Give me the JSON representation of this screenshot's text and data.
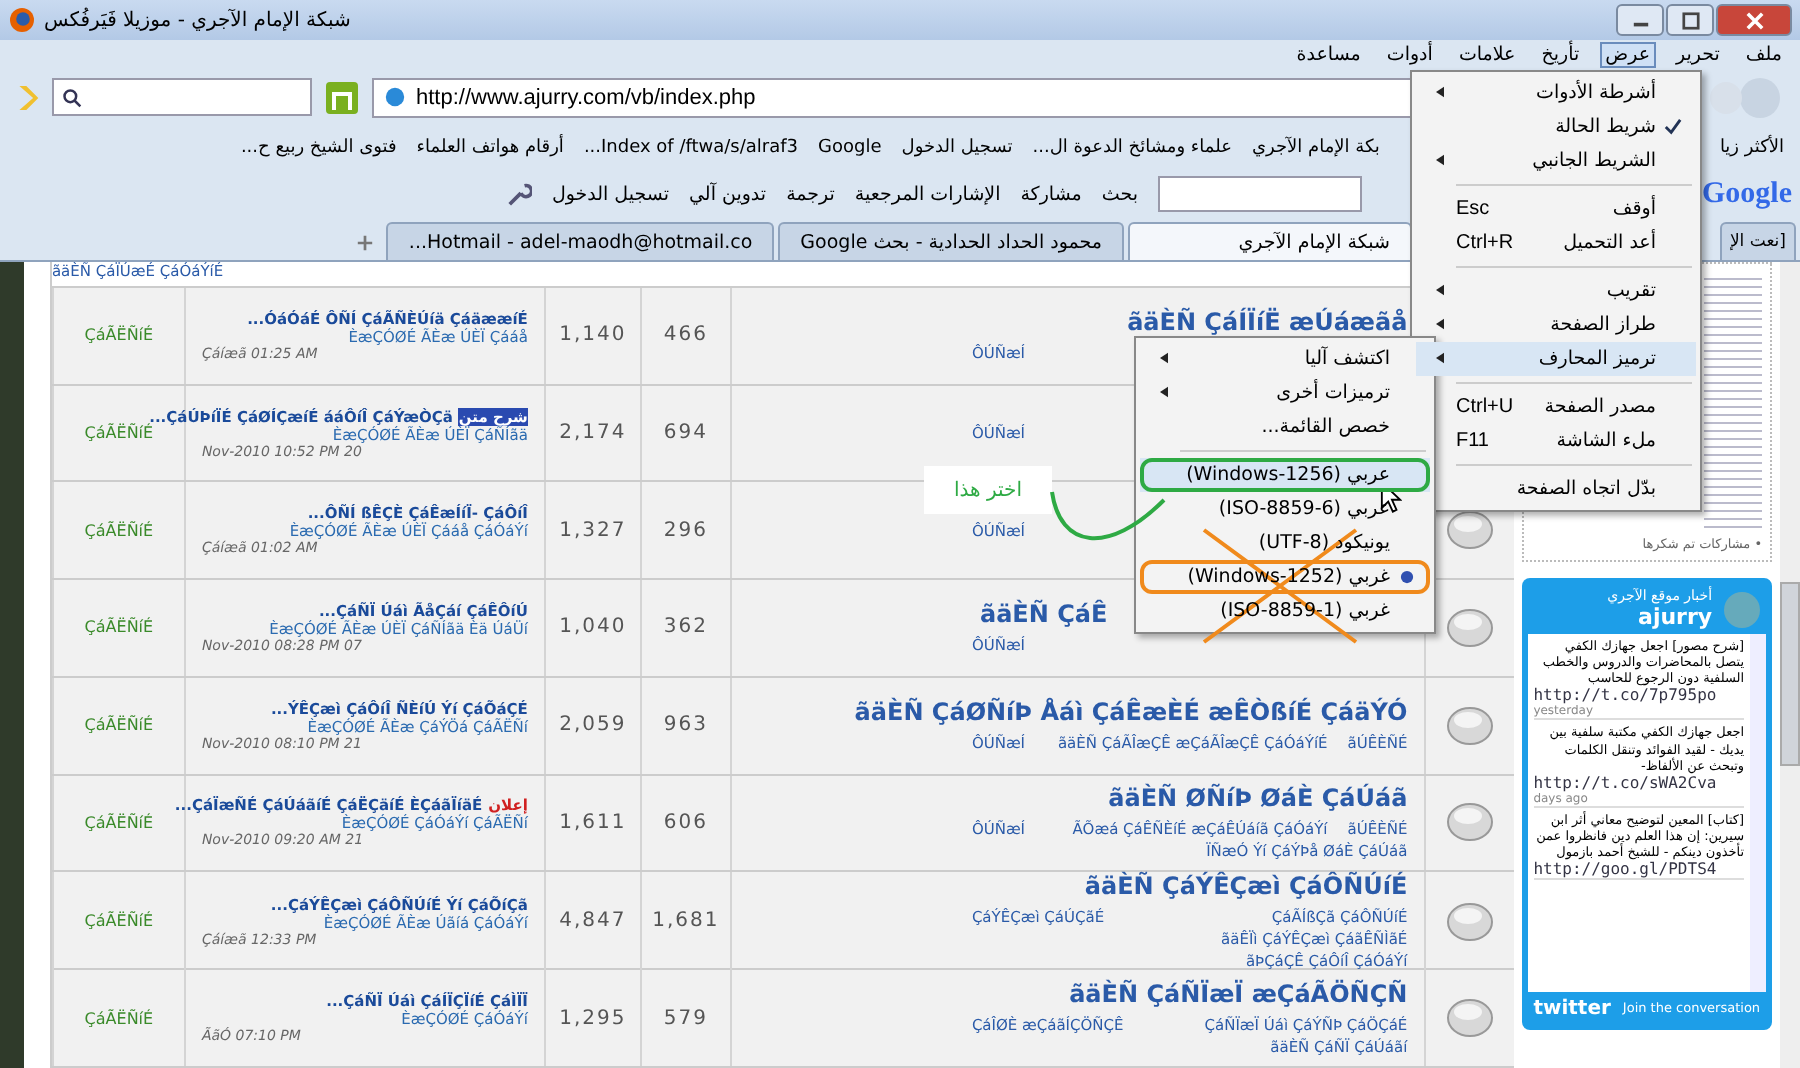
{
  "window": {
    "title": "شبكة الإمام الآجري - موزيلا فَيَرفُكس"
  },
  "menu_bar": [
    {
      "label": "ملف",
      "selected": false
    },
    {
      "label": "تحرير",
      "selected": false
    },
    {
      "label": "عرض",
      "selected": true
    },
    {
      "label": "تأريخ",
      "selected": false
    },
    {
      "label": "علامات",
      "selected": false
    },
    {
      "label": "أدوات",
      "selected": false
    },
    {
      "label": "مساعدة",
      "selected": false
    }
  ],
  "nav": {
    "url": "http://www.ajurry.com/vb/index.php"
  },
  "bookmarks": [
    "الأكثر زيا",
    "بكة الإمام الآجري",
    "علماء ومشائخ الدعوة ال...",
    "تسجيل الدخول",
    "Google",
    "Index of /ftwa/s/alraf3...",
    "أرقام هواتف العلماء",
    "فتوى الشيخ ربيع ح..."
  ],
  "google_bar": {
    "logo": "Google",
    "items": [
      "بحث",
      "مشاركة",
      "الإشارات المرجعية",
      "ترجمة",
      "تدوين آلي",
      "تسجيل الدخول"
    ]
  },
  "tabs": [
    {
      "label": "[نعت الإ",
      "selected": false
    },
    {
      "label": "شبكة الإمام الآجري",
      "selected": true
    },
    {
      "label": "محمود الحداد الحدادية - بحث Google",
      "selected": false
    },
    {
      "label": "Hotmail - adel-maodh@hotmail.co...",
      "selected": false
    }
  ],
  "table": {
    "top_line": "ãäÈÑ ÇáÏÚæÉ ÇáÓáÝíÉ",
    "rows": [
      {
        "user": "ÇáÃËÑíÉ",
        "last_title": "ÓáÓáÉ ÔÑÍ ÇáÃÑÈÚíä ÇáäææíÉ...",
        "author": "ÈæÇÓØÉ ÃÈæ ÚÈÏ Çááå",
        "date": "Çáíæã 01:25 AM",
        "number_1": "1,140",
        "number_2": "466",
        "title": "ãäÈÑ ÇáÍÏíË æÚáæãå",
        "side_link": "ÔÚÑæÍ"
      },
      {
        "user": "ÇáÃËÑíÉ",
        "prefix": {
          "text": "شرح متن",
          "kind": "highlight"
        },
        "last_title": "ÇáÚÞíÏÉ ÇáØÍÇæíÉ ááÔíÎ ÇáÝæÒÇä...",
        "author": "ÈæÇÓØÉ ÃÈæ ÚÈÏ ÇáÑÍãä",
        "date": "Nov-2010 10:52 PM 20",
        "number_1": "2,174",
        "number_2": "694",
        "side_link": "ÔÚÑæÍ"
      },
      {
        "user": "ÇáÃËÑíÉ",
        "last_title": "ÔÑÍ ßÊÇÈ ÇáÊæÍíÏ- ÇáÔíÎ...",
        "author": "ÈæÇÓØÉ ÃÈæ ÚÈÏ Çááå ÇáÓáÝí",
        "date": "Çáíæã 01:02 AM",
        "number_1": "1,327",
        "number_2": "296",
        "side_link": "ÔÚÑæÍ"
      },
      {
        "user": "ÇáÃËÑíÉ",
        "last_title": "ÇáÑÏ Úáì ÃåÇáí ÇáÊÔíÚ...",
        "author": "ÈæÇÓØÉ ÃÈæ ÚÈÏ ÇáÑÍãä Èä ÚáÜí",
        "date": "Nov-2010 08:28 PM 07",
        "number_1": "1,040",
        "number_2": "362",
        "title": "ãäÈÑ ÇáÊ",
        "side_link": "ÔÚÑæÍ"
      },
      {
        "user": "ÇáÃËÑíÉ",
        "last_title": "ÝÊÇæì ÇáÔíÎ ÑÈíÚ Ýí ÇáÕáÇÉ...",
        "author": "ÈæÇÓØÉ ÃÈæ ÇáÝÖá ÇáÃËÑí",
        "date": "Nov-2010 08:10 PM 21",
        "number_1": "2,059",
        "number_2": "963",
        "title": "ãäÈÑ ÇáØÑíÞ Åáì ÇáÊæÈÉ æÊÒßíÉ ÇáäÝÓ",
        "side_link": "ÔÚÑæÍ",
        "subforums": [
          "ãÚÊÈÑÉ",
          "ãäÈÑ ÇáÃÎæÇÊ æÇáÃÎæÇÊ ÇáÓáÝíÉ"
        ]
      },
      {
        "user": "ÇáÃËÑíÉ",
        "prefix": {
          "text": "إعلان",
          "kind": "notice"
        },
        "last_title": "ÇáÏæÑÉ ÇáÚáãíÉ ÇáËÇäíÉ ÈÇáãÏíäÉ...",
        "author": "ÈæÇÓØÉ ÇáÓáÝí ÇáÃËÑí",
        "date": "Nov-2010 09:20 AM 21",
        "number_1": "1,611",
        "number_2": "606",
        "title": "ãäÈÑ ØÑíÞ ØáÈ ÇáÚáã",
        "side_link": "ÔÚÑæÍ",
        "subforums": [
          "ãÚÊÈÑÉ",
          "ÃÕæá ÇáÊÑÈíÉ æÇáÊÚáíã ÇáÓáÝí",
          "ÏÑæÓ Ýí ÇáÝÞå ØáÈ ÇáÚáã"
        ]
      },
      {
        "user": "ÇáÃËÑíÉ",
        "last_title": "ÇáÝÊÇæì ÇáÔÑÚíÉ Ýí ÇáÕíÇã...",
        "author": "ÈæÇÓØÉ ÃÈæ Úãíá ÇáÓáÝí",
        "date": "Çáíæã 12:33 PM",
        "number_1": "4,847",
        "number_2": "1,681",
        "title": "ãäÈÑ ÇáÝÊÇæì ÇáÔÑÚíÉ",
        "side_link": "ÇáÝÊÇæì ÇáÚÇãÉ",
        "subforums": [
          "ÇáÃÍßÇã ÇáÔÑÚíÉ",
          "ãäÊÏì ÇáÝÊÇæì ÇáãÊÑÌãÉ",
          "ãÞÇáÇÊ ÇáÔíÎ ÇáÓáÝí"
        ]
      },
      {
        "user": "ÇáÃËÑíÉ",
        "last_title": "ÇáÑÏ Úáì ÇáÍÏÇÏíÉ ÇáÌÏÏ...",
        "author": "ÈæÇÓØÉ ÇáÓáÝí",
        "date": "ÃãÓ 07:10 PM",
        "number_1": "1,295",
        "number_2": "579",
        "title": "ãäÈÑ ÇáÑÏæÏ æÇáÃÖÑÇÑ",
        "side_link": "ÇáÎØÈ æÇáãÍÇÖÑÇÊ",
        "subforums": [
          "ÇáÑÏæÏ Úáì ÇáÝÑÞ ÇáÖÇáÉ",
          "ãäÈÑ ÇáÑÏ ÇáÚáãí"
        ]
      }
    ]
  },
  "sidebar": {
    "thanks": "• مشاركات تم شكرها"
  },
  "twitter": {
    "heading": "أخبار موقع الآجري",
    "account": "ajurry",
    "tweets": [
      {
        "text": "[شرح مصور] اجعل جهازك الكفي يتصل بالمحاضرات والدروس والخطب السلفية دون الرجوع للحاسب",
        "link": "http://t.co/7p795po",
        "time": "yesterday"
      },
      {
        "text": "اجعل جهازك الكفي مكتبة سلفية بين يديك - لقيد الفوائد وتنقل الكلمات وتبحث عن الألفاظ-",
        "link": "http://t.co/sWA2Cva",
        "time": "days ago"
      },
      {
        "text": "[كتاب] المعين لتوضيح معاني أثر ابن سيرين: إن هذا العلم دين فانظروا عمن تأخذون دينكم - للشيخ أحمد بازمول",
        "link": "http://goo.gl/PDTS4"
      }
    ],
    "logo": "twitter",
    "footer": "Join the conversation"
  },
  "view_menu": [
    {
      "kind": "item",
      "label": "أشرطة الأدوات",
      "submenu": true,
      "checked": false,
      "selected": false
    },
    {
      "kind": "item",
      "label": "شريط الحالة",
      "submenu": false,
      "checked": true,
      "selected": false
    },
    {
      "kind": "item",
      "label": "الشريط الجانبي",
      "submenu": true,
      "checked": false,
      "selected": false
    },
    {
      "kind": "separator"
    },
    {
      "kind": "item",
      "label": "أوقف",
      "shortcut": "Esc",
      "submenu": false,
      "checked": false,
      "selected": false
    },
    {
      "kind": "item",
      "label": "أعد التحميل",
      "shortcut": "Ctrl+R",
      "submenu": false,
      "checked": false,
      "selected": false
    },
    {
      "kind": "separator"
    },
    {
      "kind": "item",
      "label": "تقريب",
      "submenu": true,
      "checked": false,
      "selected": false
    },
    {
      "kind": "item",
      "label": "طراز الصفحة",
      "submenu": true,
      "checked": false,
      "selected": false
    },
    {
      "kind": "item",
      "label": "ترميز المحارف",
      "submenu": true,
      "checked": false,
      "selected": true
    },
    {
      "kind": "separator"
    },
    {
      "kind": "item",
      "label": "مصدر الصفحة",
      "shortcut": "Ctrl+U",
      "submenu": false,
      "checked": false,
      "selected": false
    },
    {
      "kind": "item",
      "label": "ملء الشاشة",
      "shortcut": "F11",
      "submenu": false,
      "checked": false,
      "selected": false
    },
    {
      "kind": "separator"
    },
    {
      "kind": "item",
      "label": "بدّل اتجاه الصفحة",
      "submenu": false,
      "checked": false,
      "selected": false
    }
  ],
  "encoding_menu": [
    {
      "kind": "item",
      "label": "اكتشف آليا",
      "submenu": true,
      "checked": false,
      "selected": false
    },
    {
      "kind": "item",
      "label": "ترميزات أخرى",
      "submenu": true,
      "checked": false,
      "selected": false
    },
    {
      "kind": "item",
      "label": "خصص القائمة...",
      "submenu": false,
      "checked": false,
      "selected": false
    },
    {
      "kind": "separator"
    },
    {
      "kind": "item",
      "label": "عربي (Windows-1256)",
      "submenu": false,
      "checked": false,
      "selected": true,
      "color": "#2eaa44"
    },
    {
      "kind": "item",
      "label": "عربي (ISO-8859-6)",
      "submenu": false,
      "checked": false,
      "selected": false
    },
    {
      "kind": "item",
      "label": "يونيكود (UTF-8)",
      "submenu": false,
      "checked": false,
      "selected": false
    },
    {
      "kind": "item",
      "label": "غربي (Windows-1252)",
      "submenu": false,
      "checked": true,
      "selected": false,
      "color": "#f08a1c",
      "crossed": true
    },
    {
      "kind": "item",
      "label": "غربي (ISO-8859-1)",
      "submenu": false,
      "checked": false,
      "selected": false
    }
  ],
  "annotation": {
    "note": "اختر هذا"
  }
}
